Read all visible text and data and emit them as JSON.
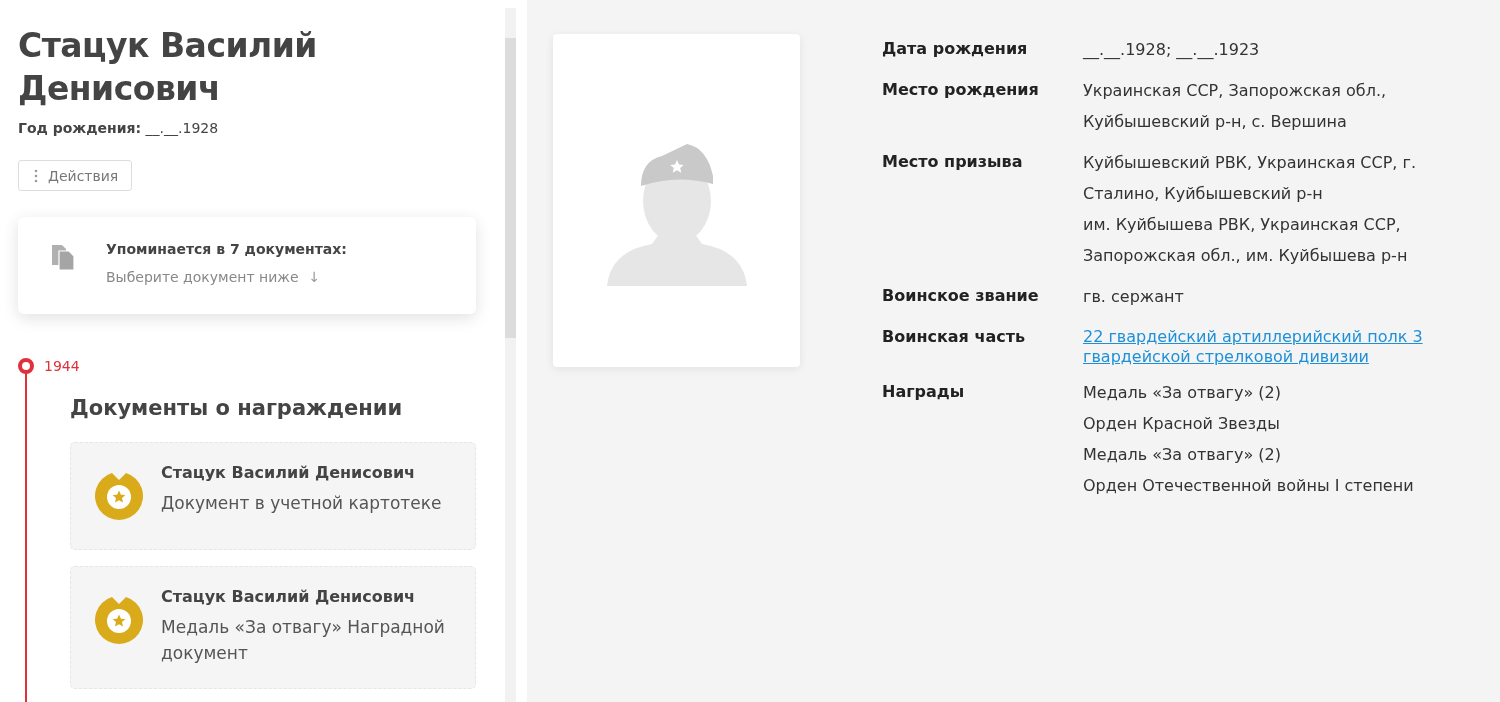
{
  "person": {
    "name": "Стацук Василий Денисович",
    "birth_label": "Год рождения:",
    "birth_value": "__.__.1928",
    "actions_button": "Действия"
  },
  "mentions": {
    "title": "Упоминается в 7 документах:",
    "hint": "Выберите документ ниже",
    "arrow": "↓"
  },
  "timeline": {
    "year": "1944",
    "section_title": "Документы о награждении",
    "documents": [
      {
        "name": "Стацук Василий Денисович",
        "description": "Документ в учетной картотеке"
      },
      {
        "name": "Стацук Василий Денисович",
        "description": "Медаль «За отвагу» Наградной документ"
      }
    ]
  },
  "photo": {
    "kind": "placeholder"
  },
  "details": [
    {
      "label": "Дата рождения",
      "kind": "text",
      "values": [
        "__.__.1928; __.__.1923"
      ]
    },
    {
      "label": "Место рождения",
      "kind": "text",
      "values": [
        "Украинская ССР, Запорожская обл., Куйбышевский р-н, с. Вершина"
      ]
    },
    {
      "label": "Место призыва",
      "kind": "text",
      "values": [
        "Куйбышевский РВК, Украинская ССР, г. Сталино, Куйбышевский р-н",
        "им. Куйбышева РВК, Украинская ССР, Запорожская обл., им. Куйбышева р-н"
      ]
    },
    {
      "label": "Воинское звание",
      "kind": "text",
      "values": [
        "гв. сержант"
      ]
    },
    {
      "label": "Воинская часть",
      "kind": "link",
      "values": [
        "22 гвардейский артиллерийский полк 3 гвардейской стрелковой дивизии"
      ]
    },
    {
      "label": "Награды",
      "kind": "text",
      "values": [
        "Медаль «За отвагу» (2)",
        "Орден Красной Звезды",
        "Медаль «За отвагу» (2)",
        "Орден Отечественной войны I степени"
      ]
    }
  ]
}
